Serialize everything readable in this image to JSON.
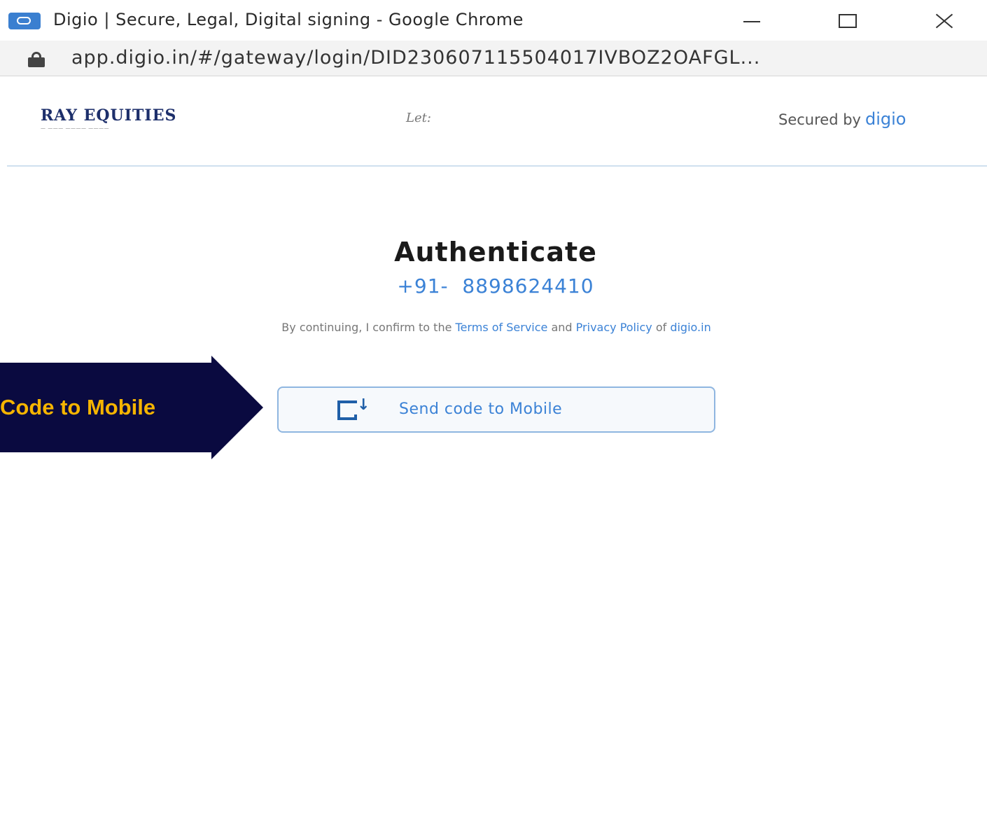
{
  "window": {
    "title": "Digio | Secure, Legal, Digital signing - Google Chrome",
    "url": "app.digio.in/#/gateway/login/DID230607115504017IVBOZ2OAFGL..."
  },
  "header": {
    "brand_name": "RAY EQUITIES",
    "brand_tagline": "— ——— ———— ————",
    "center_mark": "Let:",
    "secured_label": "Secured by",
    "secured_brand": "digio"
  },
  "auth": {
    "title": "Authenticate",
    "phone": "+91-  8898624410",
    "consent": {
      "prefix": "By continuing, I confirm to the",
      "terms": "Terms of Service",
      "and": "and",
      "privacy": "Privacy Policy",
      "of": "of",
      "site": "digio.in"
    },
    "send_button_label": "Send code to Mobile"
  },
  "annotation": {
    "text": "Code to Mobile"
  },
  "colors": {
    "accent": "#3b82d6",
    "callout_bg": "#0a0a40",
    "callout_text": "#f5b400"
  }
}
